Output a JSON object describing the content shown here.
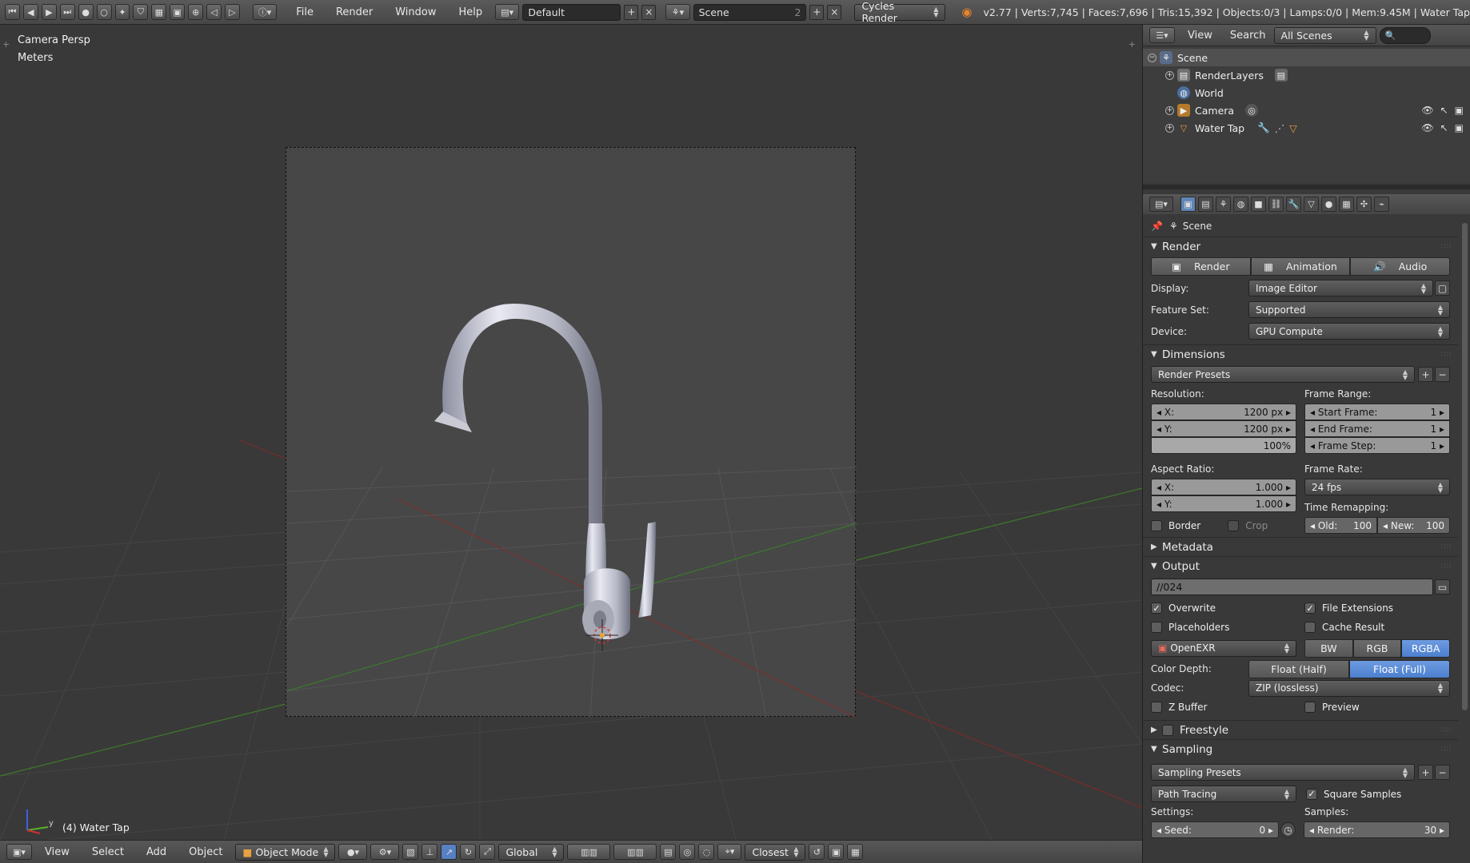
{
  "topbar": {
    "menus": [
      "File",
      "Render",
      "Window",
      "Help"
    ],
    "layout": "Default",
    "scene": "Scene",
    "scene_users": "2",
    "engine": "Cycles Render",
    "stats": "v2.77 | Verts:7,745 | Faces:7,696 | Tris:15,392 | Objects:0/3 | Lamps:0/0 | Mem:9.45M | Water Tap"
  },
  "viewport": {
    "view_name": "Camera Persp",
    "units": "Meters",
    "object_label": "(4) Water Tap"
  },
  "bottombar": {
    "menus": [
      "View",
      "Select",
      "Add",
      "Object"
    ],
    "mode": "Object Mode",
    "orientation": "Global",
    "snap": "Closest"
  },
  "outliner": {
    "menus": [
      "View",
      "Search"
    ],
    "display": "All Scenes",
    "items": [
      {
        "label": "Scene"
      },
      {
        "label": "RenderLayers"
      },
      {
        "label": "World"
      },
      {
        "label": "Camera"
      },
      {
        "label": "Water Tap"
      }
    ]
  },
  "properties": {
    "context": "Scene",
    "render": {
      "title": "Render",
      "buttons": [
        "Render",
        "Animation",
        "Audio"
      ],
      "display_label": "Display:",
      "display": "Image Editor",
      "feature_label": "Feature Set:",
      "feature": "Supported",
      "device_label": "Device:",
      "device": "GPU Compute"
    },
    "dimensions": {
      "title": "Dimensions",
      "presets": "Render Presets",
      "resolution_label": "Resolution:",
      "res_x_label": "X:",
      "res_x": "1200 px",
      "res_y_label": "Y:",
      "res_y": "1200 px",
      "res_pct": "100%",
      "frame_range_label": "Frame Range:",
      "start_label": "Start Frame:",
      "start": "1",
      "end_label": "End Frame:",
      "end": "1",
      "step_label": "Frame Step:",
      "step": "1",
      "aspect_label": "Aspect Ratio:",
      "asp_x_label": "X:",
      "asp_x": "1.000",
      "asp_y_label": "Y:",
      "asp_y": "1.000",
      "frame_rate_label": "Frame Rate:",
      "frame_rate": "24 fps",
      "remap_label": "Time Remapping:",
      "old_label": "Old:",
      "old": "100",
      "new_label": "New:",
      "new": "100",
      "border": "Border",
      "crop": "Crop"
    },
    "metadata": {
      "title": "Metadata"
    },
    "output": {
      "title": "Output",
      "path": "//024",
      "overwrite": "Overwrite",
      "file_ext": "File Extensions",
      "placeholders": "Placeholders",
      "cache": "Cache Result",
      "format": "OpenEXR",
      "channels": [
        "BW",
        "RGB",
        "RGBA"
      ],
      "depth_label": "Color Depth:",
      "depths": [
        "Float (Half)",
        "Float (Full)"
      ],
      "codec_label": "Codec:",
      "codec": "ZIP (lossless)",
      "zbuffer": "Z Buffer",
      "preview": "Preview"
    },
    "freestyle": {
      "title": "Freestyle"
    },
    "sampling": {
      "title": "Sampling",
      "presets": "Sampling Presets",
      "integrator": "Path Tracing",
      "square": "Square Samples",
      "settings_label": "Settings:",
      "samples_label": "Samples:",
      "seed_label": "Seed:",
      "seed": "0",
      "render_label": "Render:",
      "render": "30"
    }
  },
  "colors": {
    "accent": "#5680c2",
    "background": "#393939",
    "camera_frame": "#474747"
  }
}
